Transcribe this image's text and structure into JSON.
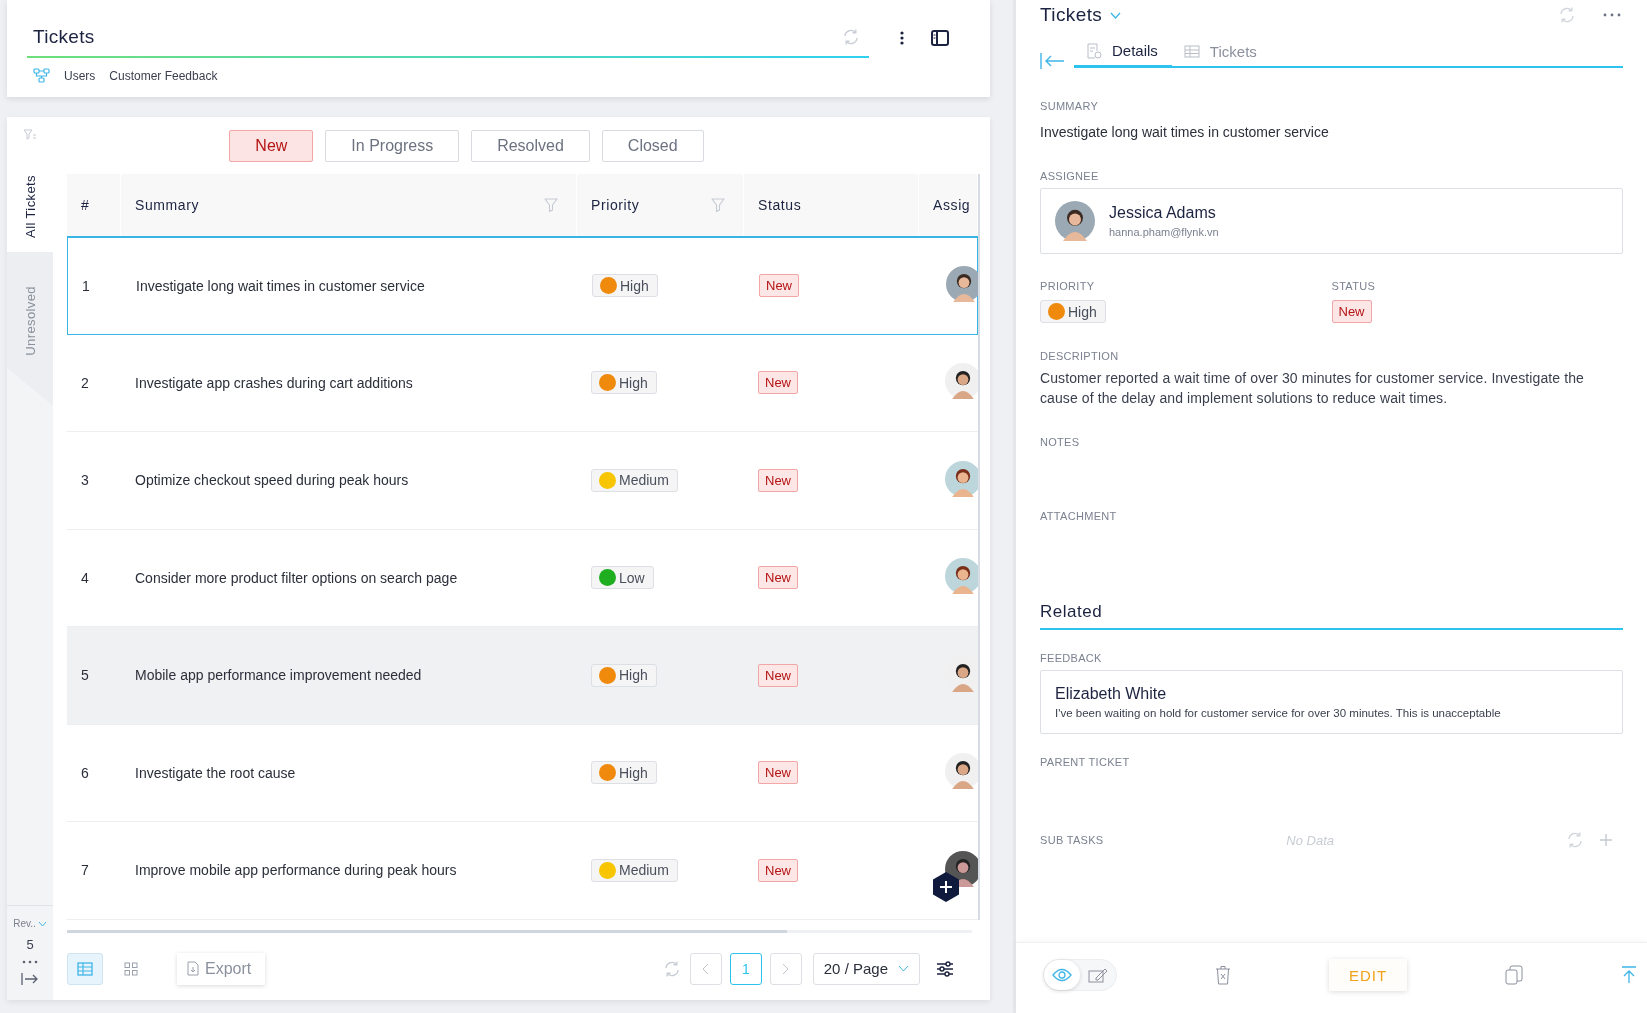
{
  "header": {
    "title": "Tickets",
    "breadcrumb": [
      "Users",
      "Customer Feedback"
    ]
  },
  "side_tabs": [
    {
      "label": "All Tickets",
      "selected": true
    },
    {
      "label": "Unresolved",
      "selected": false
    }
  ],
  "side_footer": {
    "view_label": "Rev..",
    "count": "5"
  },
  "status_filters": [
    {
      "label": "New",
      "selected": true
    },
    {
      "label": "In Progress",
      "selected": false
    },
    {
      "label": "Resolved",
      "selected": false
    },
    {
      "label": "Closed",
      "selected": false
    }
  ],
  "table": {
    "columns": [
      {
        "label": "#",
        "filterable": false
      },
      {
        "label": "Summary",
        "filterable": true
      },
      {
        "label": "Priority",
        "filterable": true
      },
      {
        "label": "Status",
        "filterable": false
      },
      {
        "label": "Assig"
      }
    ],
    "rows": [
      {
        "number": "1",
        "summary": "Investigate long wait times in customer service",
        "priority": {
          "label": "High",
          "color": "#f08a0c"
        },
        "status": "New",
        "selected": true,
        "hovered": false
      },
      {
        "number": "2",
        "summary": "Investigate app crashes during cart additions",
        "priority": {
          "label": "High",
          "color": "#f08a0c"
        },
        "status": "New",
        "selected": false,
        "hovered": false
      },
      {
        "number": "3",
        "summary": "Optimize checkout speed during peak hours",
        "priority": {
          "label": "Medium",
          "color": "#f7c600"
        },
        "status": "New",
        "selected": false,
        "hovered": false
      },
      {
        "number": "4",
        "summary": "Consider more product filter options on search page",
        "priority": {
          "label": "Low",
          "color": "#1fae1f"
        },
        "status": "New",
        "selected": false,
        "hovered": false
      },
      {
        "number": "5",
        "summary": "Mobile app performance improvement needed",
        "priority": {
          "label": "High",
          "color": "#f08a0c"
        },
        "status": "New",
        "selected": false,
        "hovered": true
      },
      {
        "number": "6",
        "summary": "Investigate the root cause",
        "priority": {
          "label": "High",
          "color": "#f08a0c"
        },
        "status": "New",
        "selected": false,
        "hovered": false
      },
      {
        "number": "7",
        "summary": "Improve mobile app performance during peak hours",
        "priority": {
          "label": "Medium",
          "color": "#f7c600"
        },
        "status": "New",
        "selected": false,
        "hovered": false
      }
    ]
  },
  "footer": {
    "views": [
      {
        "kind": "table",
        "selected": true
      },
      {
        "kind": "grid",
        "selected": false
      }
    ],
    "export": "Export",
    "page": "1",
    "page_size": "20 / Page"
  },
  "detail": {
    "title": "Tickets",
    "tabs": [
      {
        "label": "Details",
        "kind": "details",
        "selected": true
      },
      {
        "label": "Tickets",
        "kind": "table",
        "selected": false
      }
    ],
    "summary_label": "SUMMARY",
    "summary": "Investigate long wait times in customer service",
    "assignee_label": "ASSIGNEE",
    "assignee": {
      "name": "Jessica Adams",
      "email": "hanna.pham@flynk.vn"
    },
    "priority_label": "PRIORITY",
    "priority": {
      "label": "High",
      "color": "#f08a0c"
    },
    "status_label": "STATUS",
    "status": "New",
    "description_label": "DESCRIPTION",
    "description": "Customer reported a wait time of over 30 minutes for customer service. Investigate the cause of the delay and implement solutions to reduce wait times.",
    "notes_label": "NOTES",
    "attachment_label": "ATTACHMENT",
    "related_title": "Related",
    "feedback_label": "FEEDBACK",
    "feedback": {
      "name": "Elizabeth White",
      "text": "I've been waiting on hold for customer service for over 30 minutes. This is unacceptable"
    },
    "parent_label": "PARENT TICKET",
    "subtasks_label": "SUB TASKS",
    "subtasks_empty": "No Data",
    "modes": [
      {
        "kind": "view",
        "selected": true
      },
      {
        "kind": "edit",
        "selected": false
      }
    ],
    "edit_button": "EDIT"
  }
}
